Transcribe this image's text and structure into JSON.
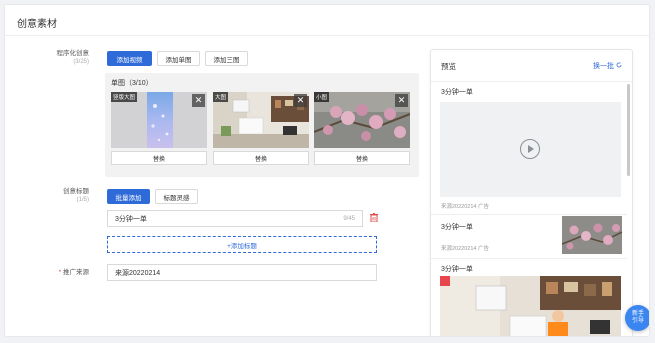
{
  "page": {
    "title": "创意素材"
  },
  "programmatic": {
    "label": "程序化创意",
    "count": "(3/25)",
    "buttons": [
      "添加视频",
      "添加单图",
      "添加三图"
    ],
    "group_title": "单图（3/10）",
    "images": [
      {
        "tag": "竖版大图",
        "replace": "替换"
      },
      {
        "tag": "大图",
        "replace": "替换"
      },
      {
        "tag": "小图",
        "replace": "替换"
      }
    ],
    "close_glyph": "✕"
  },
  "titles": {
    "label": "创意标题",
    "count": "(1/5)",
    "buttons": [
      "批量添加",
      "标题灵感"
    ],
    "items": [
      {
        "value": "3分钟一单",
        "count": "9/45"
      }
    ],
    "add_label": "+添加标题"
  },
  "source": {
    "required_mark": "*",
    "label": "推广来源",
    "value": "来源20220214"
  },
  "preview": {
    "title": "预览",
    "refresh": "换一批",
    "items": [
      {
        "title": "3分钟一单",
        "meta": "来源20220214  广告"
      },
      {
        "title": "3分钟一单",
        "meta": "来源20220214  广告"
      },
      {
        "title": "3分钟一单"
      }
    ]
  },
  "fab": {
    "line1": "新手",
    "line2": "引导"
  },
  "colors": {
    "primary": "#2f6bd8",
    "danger": "#e24b4b"
  }
}
